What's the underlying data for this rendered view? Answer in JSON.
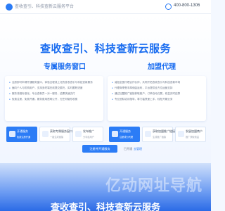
{
  "header": {
    "brand": "查收查引、科技查新云服务平台",
    "phone": "400-800-1306"
  },
  "hero": {
    "title": "查收查引、科技查新云服务"
  },
  "left": {
    "title": "专属服务窗口",
    "bullets": [
      "注册即可申请开通服务窗口，体验全程线上化的查收查引与科技查新服务",
      "面向个人与机构用户，支持多终端在线提交委托，实时跟踪进度",
      "服务流程标准化，专业查新员一对一服务，结果快速交付",
      "免费注册，免费开通，服务费用透明公开，无任何隐形收费"
    ],
    "steps": [
      {
        "label": "开通服务",
        "sub": "免费注册开通"
      },
      {
        "label": "获取专属服务窗口链接",
        "sub": "一键生成链接"
      },
      {
        "label": "发布推广",
        "sub": "分享给用户"
      }
    ]
  },
  "right": {
    "title": "加盟代理",
    "bullets": [
      "诚招全国代理合作伙伴，共同开拓查收查引与科技查新市场",
      "代理商享受丰厚佣金返利，平台提供全方位运营支持",
      "通过加盟推广链接获取客户，订单自动归属，收益实时结算",
      "专业团队培训指导，零门槛快速上手，轻松开展业务"
    ],
    "steps": [
      {
        "label": "开通服务",
        "sub": "注册成为代理"
      },
      {
        "label": "获取加盟推广链接",
        "sub": "生成推广链接"
      },
      {
        "label": "发展加盟商户",
        "sub": "推广获取收益"
      }
    ]
  },
  "cta": {
    "button": "注册并开通服务",
    "hint": "已开通",
    "link": "去管理"
  },
  "footer": {
    "watermark": "亿动网址导航",
    "subtitle": "查收查引、科技查新云服务"
  }
}
